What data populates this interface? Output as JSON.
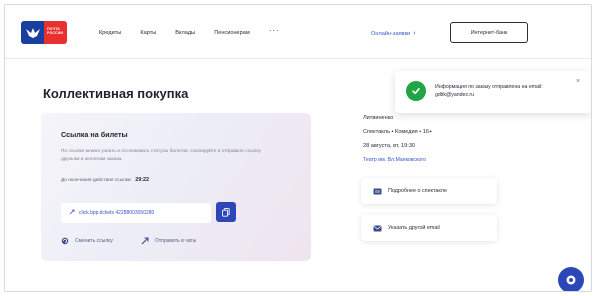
{
  "header": {
    "logo_text": "ПОЧТА РОССИИ",
    "nav": [
      "Кредиты",
      "Карты",
      "Вклады",
      "Пенсионерам"
    ],
    "nav_more": "···",
    "lk_link": "Онлайн-заявки",
    "lk_arrow": "›",
    "shop_button": "Интернет-банк"
  },
  "toast": {
    "text": "Информация по заказу отправлена на email: gdtik@yandex.ru",
    "close": "×"
  },
  "page_title": "Коллективная покупка",
  "card": {
    "title": "Ссылка на билеты",
    "description": "По ссылке можно узнать и отслеживать статусы билетов. Скопируйте и отправьте ссылку друзьям и коллегам заказа.",
    "timer_label": "До окончания действия ссылки:",
    "timer_value": "29:22",
    "link_text": "click.bpp.tickets 42288003050280",
    "actions": [
      "Сменить ссылку",
      "Отправить в чаты"
    ]
  },
  "info": {
    "name": "Литвиненко",
    "route": "Спектакль • Комедия • 16+",
    "date": "28 августа, вт, 19:30",
    "seat": "Театр им. Вл.Маяковского"
  },
  "side_buttons": {
    "details": "Подробнее о спектакле",
    "email": "Указать другой email"
  },
  "colors": {
    "brand_blue": "#2e47b8",
    "brand_red": "#e8312f",
    "success_green": "#1fa543",
    "link_blue": "#3b54c7"
  },
  "icons": [
    "logo-eagle-icon",
    "check-icon",
    "close-icon",
    "link-icon",
    "copy-icon",
    "refresh-icon",
    "share-icon",
    "ticket-icon",
    "mail-icon",
    "chat-icon"
  ]
}
